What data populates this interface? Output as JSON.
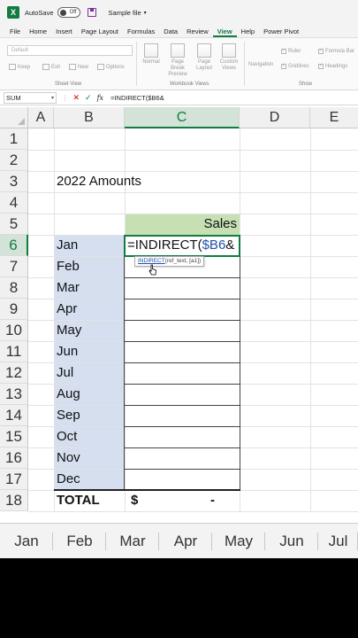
{
  "titlebar": {
    "app_icon": "X",
    "autosave_label": "AutoSave",
    "autosave_state": "Off",
    "filename": "Sample file",
    "save_icon": "save-icon"
  },
  "menu": [
    "File",
    "Home",
    "Insert",
    "Page Layout",
    "Formulas",
    "Data",
    "Review",
    "View",
    "Help",
    "Power Pivot"
  ],
  "menu_active": "View",
  "ribbon": {
    "sheet_view_select": "Default",
    "sheet_view_buttons": [
      "Keep",
      "Exit",
      "New",
      "Options"
    ],
    "sheet_view_label": "Sheet View",
    "workbook_views": [
      "Normal",
      "Page Break Preview",
      "Page Layout",
      "Custom Views"
    ],
    "workbook_views_label": "Workbook Views",
    "navigation": "Navigation",
    "show_options": [
      "Ruler",
      "Gridlines",
      "Formula Bar",
      "Headings"
    ],
    "show_label": "Show"
  },
  "formula_bar": {
    "name_box": "SUM",
    "dots": "⋮",
    "cancel": "✕",
    "enter": "✓",
    "fx": "fx",
    "content": "=INDIRECT($B6&"
  },
  "columns": [
    "A",
    "B",
    "C",
    "D",
    "E"
  ],
  "rows": [
    "1",
    "2",
    "3",
    "4",
    "5",
    "6",
    "7",
    "8",
    "9",
    "10",
    "11",
    "12",
    "13",
    "14",
    "15",
    "16",
    "17",
    "18"
  ],
  "sheet": {
    "title": "2022 Amounts",
    "sales_header": "Sales",
    "months": [
      "Jan",
      "Feb",
      "Mar",
      "Apr",
      "May",
      "Jun",
      "Jul",
      "Aug",
      "Sep",
      "Oct",
      "Nov",
      "Dec"
    ],
    "formula_prefix": "=INDIRECT(",
    "formula_ref": "$B6",
    "formula_suffix": "&",
    "total_label": "TOTAL",
    "total_currency": "$",
    "total_value": "-"
  },
  "tooltip": {
    "function": "INDIRECT",
    "args": "(ref_text, [a1])"
  },
  "sheet_tabs": [
    "Jan",
    "Feb",
    "Mar",
    "Apr",
    "May",
    "Jun",
    "Jul"
  ]
}
